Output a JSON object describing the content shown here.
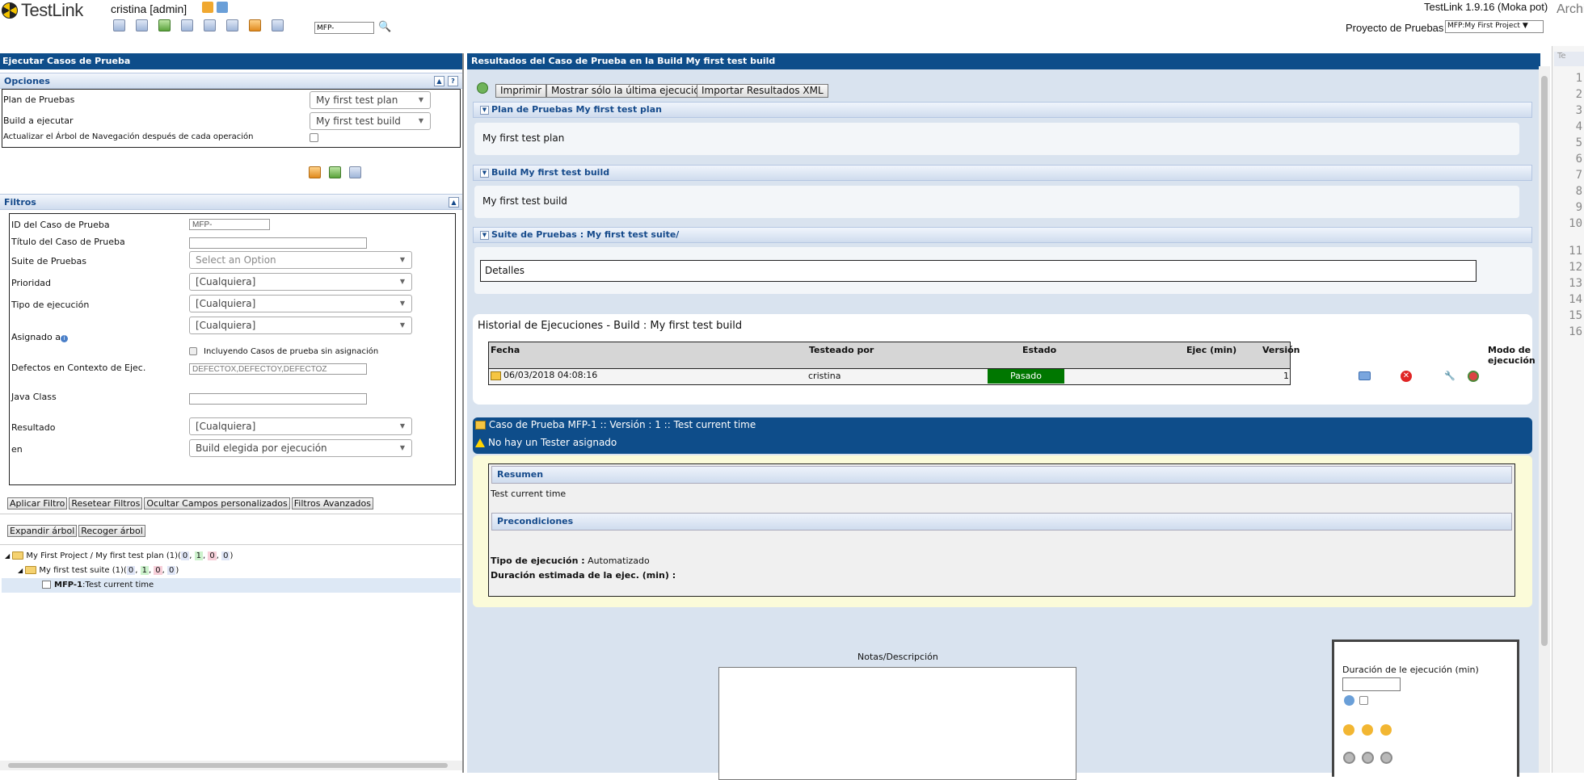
{
  "header": {
    "logo_text": "TestLink",
    "user_label": "cristina [admin]",
    "search_value": "MFP-",
    "version": "TestLink 1.9.16 (Moka pot)",
    "project_label": "Proyecto de Pruebas",
    "project_value": "MFP:My First Project",
    "side_text": "Archi"
  },
  "left": {
    "title": "Ejecutar Casos de Prueba",
    "options": {
      "heading": "Opciones",
      "plan_label": "Plan de Pruebas",
      "plan_value": "My first test plan",
      "build_label": "Build a ejecutar",
      "build_value": "My first test build",
      "update_tree_label": "Actualizar el Árbol de Navegación después de cada operación"
    },
    "filters": {
      "heading": "Filtros",
      "tc_id_label": "ID del Caso de Prueba",
      "tc_id_value": "MFP-",
      "tc_title_label": "Título del Caso de Prueba",
      "suite_label": "Suite de Pruebas",
      "suite_placeholder": "Select an Option",
      "priority_label": "Prioridad",
      "priority_value": "[Cualquiera]",
      "exec_type_label": "Tipo de ejecución",
      "exec_type_value": "[Cualquiera]",
      "assigned_label": "Asignado a",
      "assigned_value": "[Cualquiera]",
      "include_unassigned_label": "Incluyendo Casos de prueba sin asignación",
      "defects_label": "Defectos en Contexto de Ejec.",
      "defects_value": "DEFECTOX,DEFECTOY,DEFECTOZ",
      "java_class_label": "Java Class",
      "result_label": "Resultado",
      "result_value": "[Cualquiera]",
      "on_label": "en",
      "on_value": "Build elegida por ejecución"
    },
    "filter_buttons": [
      "Aplicar Filtro",
      "Resetear Filtros",
      "Ocultar Campos personalizados",
      "Filtros Avanzados"
    ],
    "tree_buttons": [
      "Expandir árbol",
      "Recoger árbol"
    ],
    "tree": {
      "root": "My First Project / My first test plan (1)(",
      "root_counts": [
        "0",
        "1",
        "0",
        "0"
      ],
      "suite": "My first test suite (1)(",
      "suite_counts": [
        "0",
        "1",
        "0",
        "0"
      ],
      "case_id": "MFP-1",
      "case_title": ":Test current time"
    }
  },
  "right": {
    "title": "Resultados del Caso de Prueba en la Build My first test build",
    "buttons": [
      "Imprimir",
      "Mostrar sólo la última ejecución",
      "Importar Resultados XML"
    ],
    "plan_section": "Plan de Pruebas My first test plan",
    "plan_text": "My first test plan",
    "build_section": "Build My first test build",
    "build_text": "My first test build",
    "suite_section": "Suite de Pruebas : My first test suite/",
    "details_label": "Detalles",
    "history_title": "Historial de Ejecuciones - Build : My first test build",
    "history_columns": [
      "Fecha",
      "Testeado por",
      "Estado",
      "Ejec (min)",
      "Versión",
      "Modo de ejecución"
    ],
    "history_row": {
      "date": "06/03/2018 04:08:16",
      "tester": "cristina",
      "status": "Pasado",
      "version": "1"
    },
    "status_color": "#007700",
    "tc_header": "Caso de Prueba MFP-1 :: Versión : 1 :: Test current time",
    "no_tester": "No hay un Tester asignado",
    "summary_heading": "Resumen",
    "summary_text": "Test current time",
    "preconditions_heading": "Precondiciones",
    "exec_type_label": "Tipo de ejecución :",
    "exec_type_value": "Automatizado",
    "est_duration_label": "Duración estimada de la ejec. (min) :",
    "notes_label": "Notas/Descripción",
    "duration_label": "Duración de le ejecución (min)"
  },
  "strip": {
    "tab": "Te",
    "line_numbers": [
      "1",
      "2",
      "3",
      "4",
      "5",
      "6",
      "7",
      "8",
      "9",
      "10",
      "11",
      "12",
      "13",
      "14",
      "15",
      "16"
    ]
  }
}
